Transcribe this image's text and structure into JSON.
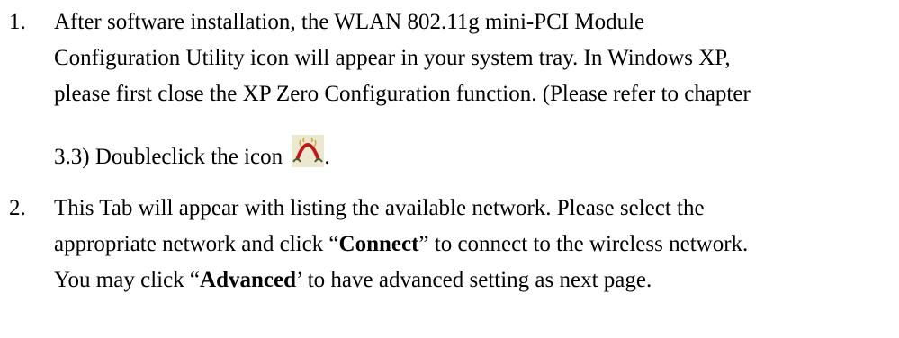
{
  "items": [
    {
      "number": "1.",
      "lines": [
        "After software installation, the WLAN 802.11g mini-PCI Module",
        "Configuration Utility icon will appear in your system tray. In Windows XP,",
        "please first close the XP Zero Configuration function. (Please refer to chapter",
        "3.3) Doubleclick the icon "
      ],
      "line4_end": ".",
      "icon": "wireless-utility-icon"
    },
    {
      "number": "2.",
      "line1": "This Tab will appear with listing the available network. Please select the",
      "line2_pre": "appropriate network and click “",
      "line2_bold": "Connect",
      "line2_post": "” to connect to the wireless network.",
      "line3_pre": "You may click “",
      "line3_bold": "Advanced",
      "line3_post": "’ to have advanced setting as next page."
    }
  ]
}
